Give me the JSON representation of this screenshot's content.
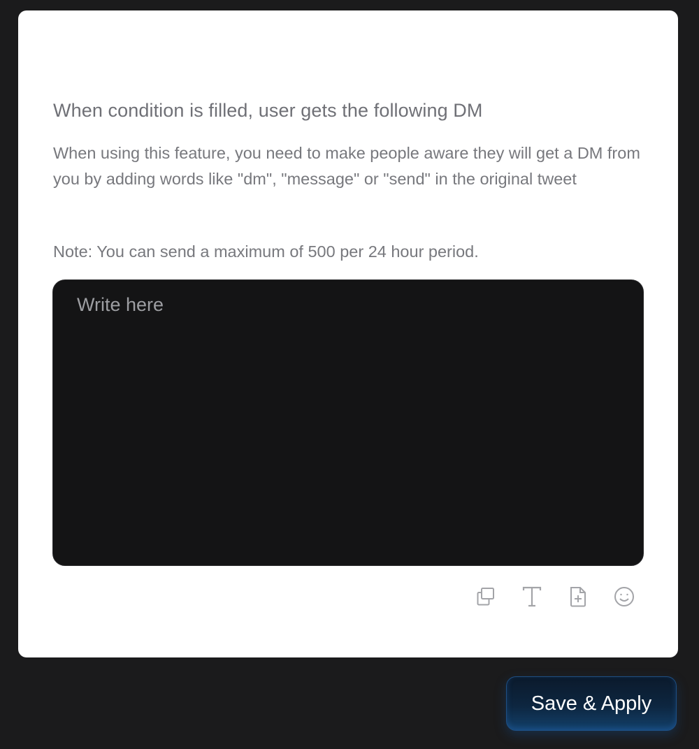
{
  "card": {
    "heading": "When condition is filled, user gets the following DM",
    "description": "When using this feature, you need to make people aware they will get a DM from you by adding words like \"dm\", \"message\" or \"send\" in the original tweet",
    "note": "Note: You can send a maximum of 500 per 24 hour period."
  },
  "editor": {
    "placeholder": "Write here",
    "value": ""
  },
  "toolbar": {
    "icons": [
      "copy-icon",
      "text-format-icon",
      "add-file-icon",
      "emoji-icon"
    ]
  },
  "actions": {
    "save_label": "Save & Apply"
  },
  "colors": {
    "background": "#1b1b1c",
    "card": "#ffffff",
    "editor": "#141415",
    "button": "#0d2640"
  }
}
